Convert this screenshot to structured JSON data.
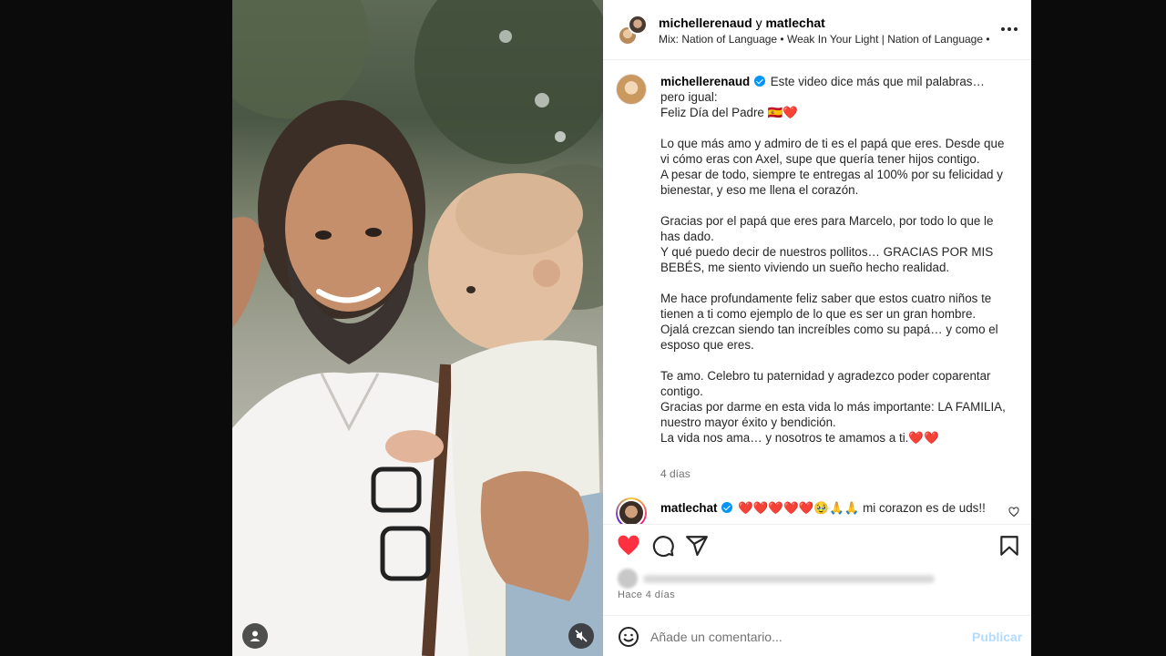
{
  "header": {
    "user1": "michellerenaud",
    "conjunction": "y",
    "user2": "matlechat",
    "audio": "Mix: Nation of Language • Weak In Your Light | Nation of Language •",
    "more_icon": "more-horizontal-icon"
  },
  "caption": {
    "username": "michellerenaud",
    "first_line": "Este video dice más que mil palabras…",
    "line_2": "pero igual:",
    "line_3": "Feliz Día del Padre 🇪🇸❤️",
    "p2": "Lo que más amo y admiro de ti es el papá que eres. Desde que vi cómo eras con Axel, supe que quería tener hijos contigo.",
    "p2b": "A pesar de todo, siempre te entregas al 100% por su felicidad y bienestar, y eso me llena el corazón.",
    "p3": "Gracias por el papá que eres para Marcelo, por todo lo que le has dado.",
    "p3b": "Y qué puedo decir de nuestros pollitos… GRACIAS POR MIS BEBÉS, me siento viviendo un sueño hecho realidad.",
    "p4": "Me hace profundamente feliz saber que estos cuatro niños te tienen a ti como ejemplo de lo que es ser un gran hombre.",
    "p4b": "Ojalá crezcan siendo tan increíbles como su papá… y como el esposo que eres.",
    "p5": "Te amo. Celebro tu paternidad y agradezco poder coparentar contigo.",
    "p5b": "Gracias por darme en esta vida lo más importante: LA FAMILIA, nuestro mayor éxito y bendición.",
    "p5c": "La vida nos ama… y nosotros te amamos a ti.❤️❤️",
    "time": "4 días"
  },
  "comment": {
    "username": "matlechat",
    "text": "❤️❤️❤️❤️❤️🥹🙏🙏 mi corazon es de uds!!"
  },
  "actions": {
    "icons": [
      "heart-filled-icon",
      "comment-icon",
      "share-icon",
      "bookmark-icon"
    ],
    "liked_color": "#ff3040",
    "post_time": "Hace 4 días"
  },
  "add_comment": {
    "placeholder": "Añade un comentario...",
    "publish_label": "Publicar",
    "publish_color": "#b3dbff"
  }
}
